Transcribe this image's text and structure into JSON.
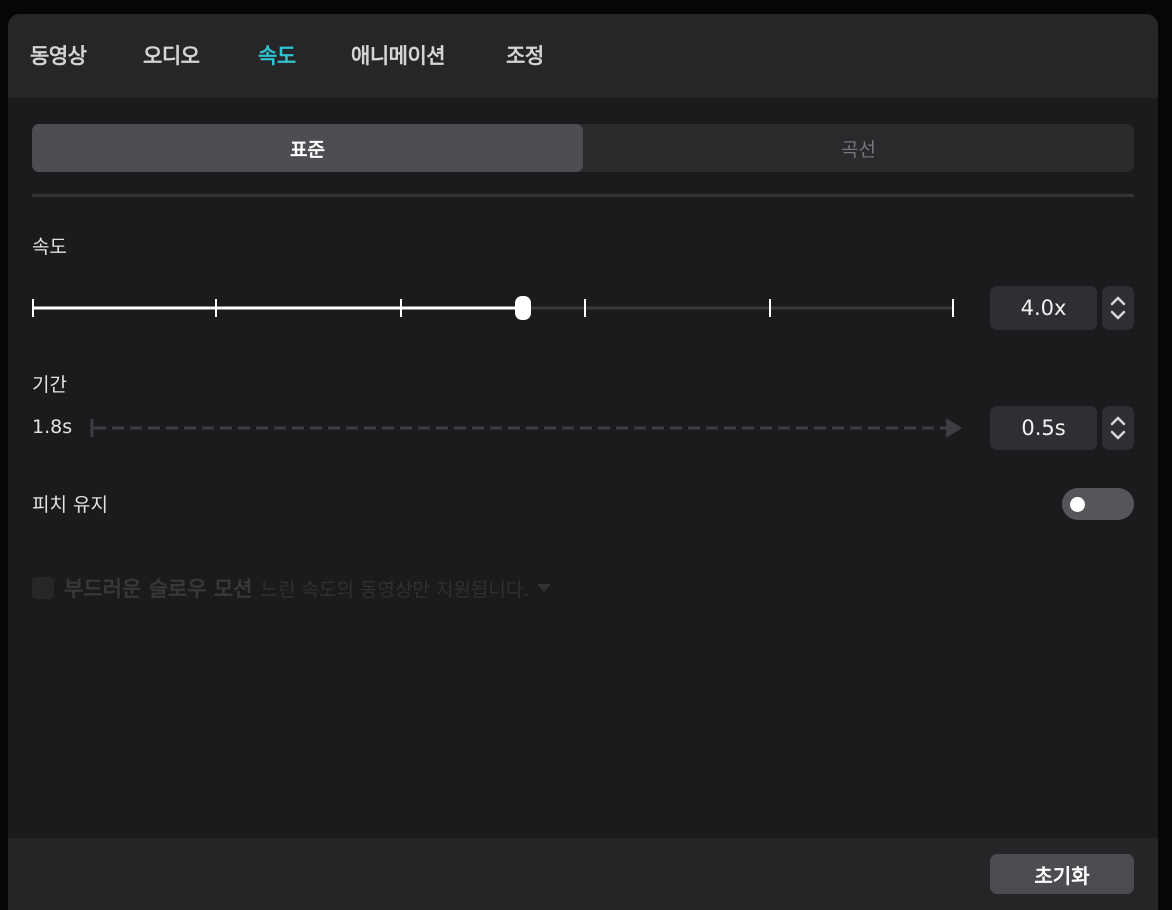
{
  "tabs": [
    {
      "label": "동영상"
    },
    {
      "label": "오디오"
    },
    {
      "label": "속도",
      "active": true
    },
    {
      "label": "애니메이션"
    },
    {
      "label": "조정"
    }
  ],
  "mode": {
    "standard": "표준",
    "curve": "곡선",
    "selected": "표준"
  },
  "speed": {
    "label": "속도",
    "value": "4.0x",
    "slider_fraction": 0.533
  },
  "duration": {
    "label": "기간",
    "original": "1.8s",
    "value": "0.5s"
  },
  "keep_pitch": {
    "label": "피치 유지",
    "enabled": false
  },
  "smooth_slow_motion": {
    "label": "부드러운 슬로우 모션",
    "note": "느린 속도의 동영상만 지원됩니다."
  },
  "footer": {
    "reset_label": "초기화"
  },
  "colors": {
    "accent": "#2fc3d0",
    "panel": "#1b1b1d",
    "tabbar": "#262629"
  },
  "icons": {
    "spin": "chevron-up-down-icon",
    "caret": "caret-down-icon",
    "arrow": "arrow-right-icon"
  }
}
